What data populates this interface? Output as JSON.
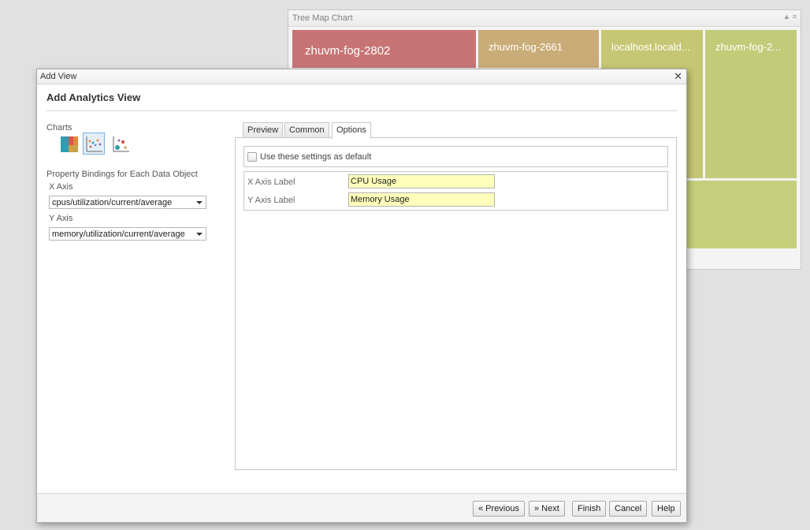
{
  "treemap": {
    "title": "Tree Map Chart",
    "tiles": [
      {
        "label": "zhuvm-fog-2802",
        "color": "#c87474"
      },
      {
        "label": "zhuvm-fog-2661",
        "color": "#c9ac77"
      },
      {
        "label": "localhost.locald...",
        "color": "#c5c774"
      },
      {
        "label": "zhuvm-fog-2...",
        "color": "#c2cb78"
      },
      {
        "label": "",
        "color": "#c5cf7b"
      }
    ]
  },
  "dialog": {
    "title": "Add View",
    "heading": "Add Analytics View",
    "charts_label": "Charts",
    "chart_icons": [
      "treemap-chart-icon",
      "scatter-chart-icon",
      "bubble-chart-icon"
    ],
    "bindings_label": "Property Bindings for Each Data Object",
    "x_axis_label": "X Axis",
    "x_axis_value": "cpus/utilization/current/average",
    "y_axis_label": "Y Axis",
    "y_axis_value": "memory/utilization/current/average",
    "tabs": [
      "Preview",
      "Common",
      "Options"
    ],
    "active_tab": "Options",
    "options": {
      "default_checkbox_label": "Use these settings as default",
      "x_axis_label_caption": "X Axis Label",
      "x_axis_label_value": "CPU Usage",
      "y_axis_label_caption": "Y Axis Label",
      "y_axis_label_value": "Memory Usage"
    },
    "buttons": {
      "previous": "« Previous",
      "next": "» Next",
      "finish": "Finish",
      "cancel": "Cancel",
      "help": "Help"
    }
  }
}
